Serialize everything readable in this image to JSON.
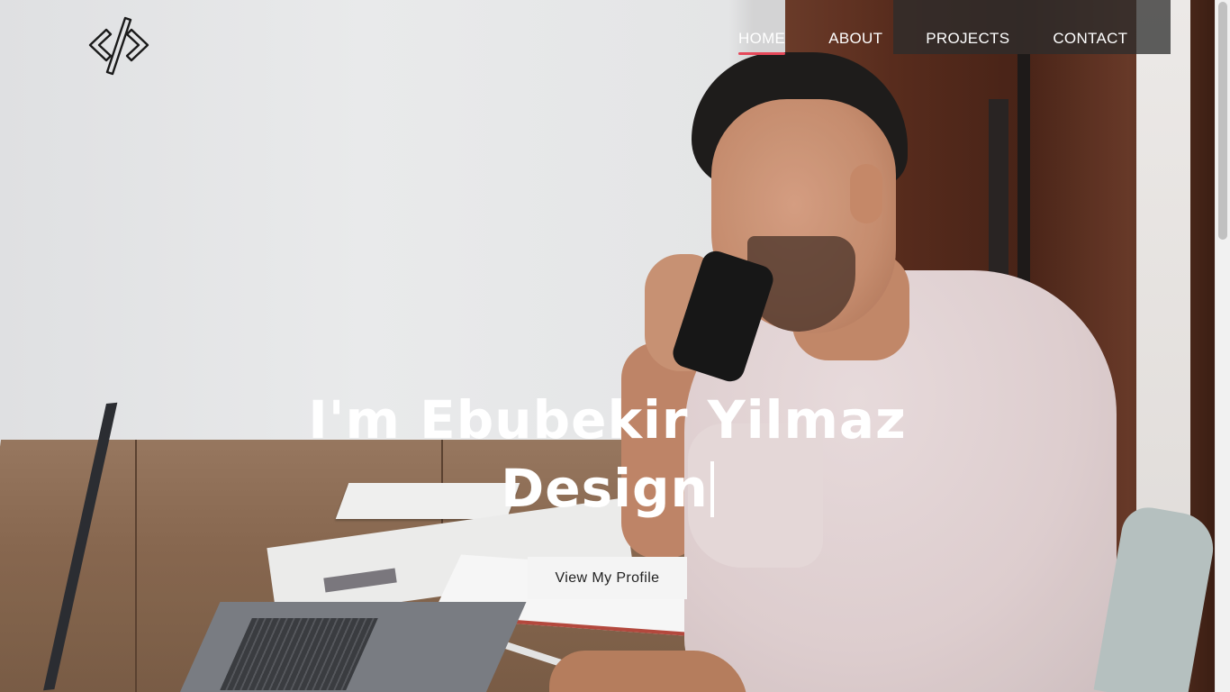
{
  "logo": {
    "icon": "code-brackets-icon"
  },
  "nav": {
    "items": [
      {
        "label": "HOME",
        "active": true
      },
      {
        "label": "ABOUT",
        "active": false
      },
      {
        "label": "PROJECTS",
        "active": false
      },
      {
        "label": "CONTACT",
        "active": false
      }
    ],
    "active_underline_color": "#e5485a"
  },
  "hero": {
    "title_line1": "I'm Ebubekir Yilmaz",
    "title_line2": "Design",
    "cta_label": "View My Profile"
  },
  "colors": {
    "text_on_image": "#ffffff",
    "button_bg": "#f4f4f4",
    "button_text": "#222222"
  }
}
